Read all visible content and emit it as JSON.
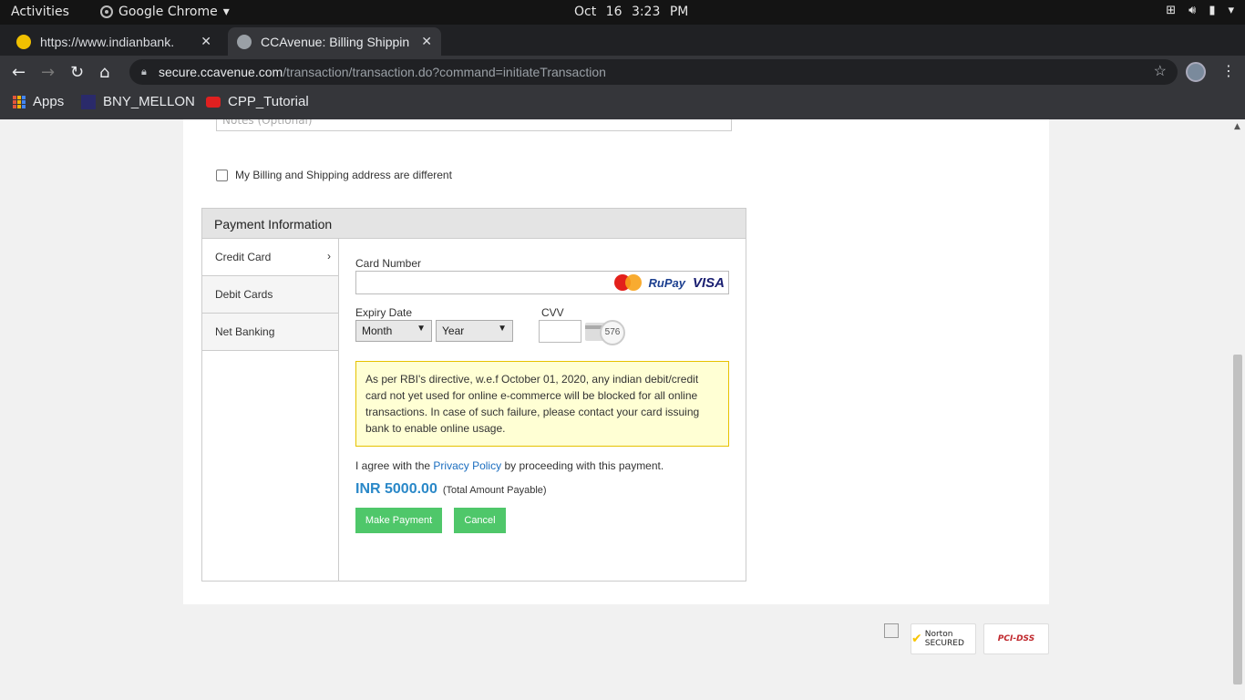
{
  "system_bar": {
    "activities": "Activities",
    "app_name": "Google Chrome",
    "date": "Oct 16",
    "time": "3:23 PM"
  },
  "browser": {
    "tabs": [
      {
        "title": "https://www.indianbank.",
        "active": false
      },
      {
        "title": "CCAvenue: Billing Shippin",
        "active": true
      }
    ],
    "url_host": "secure.ccavenue.com",
    "url_path": "/transaction/transaction.do?command=initiateTransaction",
    "bookmarks": [
      {
        "label": "Apps",
        "icon": "apps-grid-icon"
      },
      {
        "label": "BNY_MELLON",
        "icon": "bny-icon"
      },
      {
        "label": "CPP_Tutorial",
        "icon": "youtube-icon"
      }
    ]
  },
  "page": {
    "notes_placeholder": "Notes (Optional)",
    "different_address_label": "My Billing and Shipping address are different",
    "payment_section_title": "Payment Information",
    "payment_methods": [
      "Credit Card",
      "Debit Cards",
      "Net Banking"
    ],
    "selected_method": "Credit Card",
    "card_number_label": "Card Number",
    "card_logos": [
      "MasterCard",
      "RuPay",
      "VISA"
    ],
    "expiry_label": "Expiry Date",
    "expiry_month": "Month",
    "expiry_year": "Year",
    "cvv_label": "CVV",
    "cvv_hint": "576",
    "rbi_notice": "As per RBI's directive, w.e.f October 01, 2020, any indian debit/credit card not yet used for online e-commerce will be blocked for all online transactions. In case of such failure, please contact your card issuing bank to enable online usage.",
    "agree_prefix": "I agree with the",
    "privacy_link": "Privacy Policy",
    "agree_suffix": "by proceeding with this payment.",
    "amount": "INR 5000.00",
    "amount_note": "(Total Amount Payable)",
    "make_payment": "Make Payment",
    "cancel": "Cancel",
    "seals": [
      "Norton SECURED",
      "PCI-DSS"
    ]
  },
  "colors": {
    "accent_button": "#4fc76a",
    "amount_blue": "#2a88c8",
    "notice_bg": "#ffffd4"
  }
}
